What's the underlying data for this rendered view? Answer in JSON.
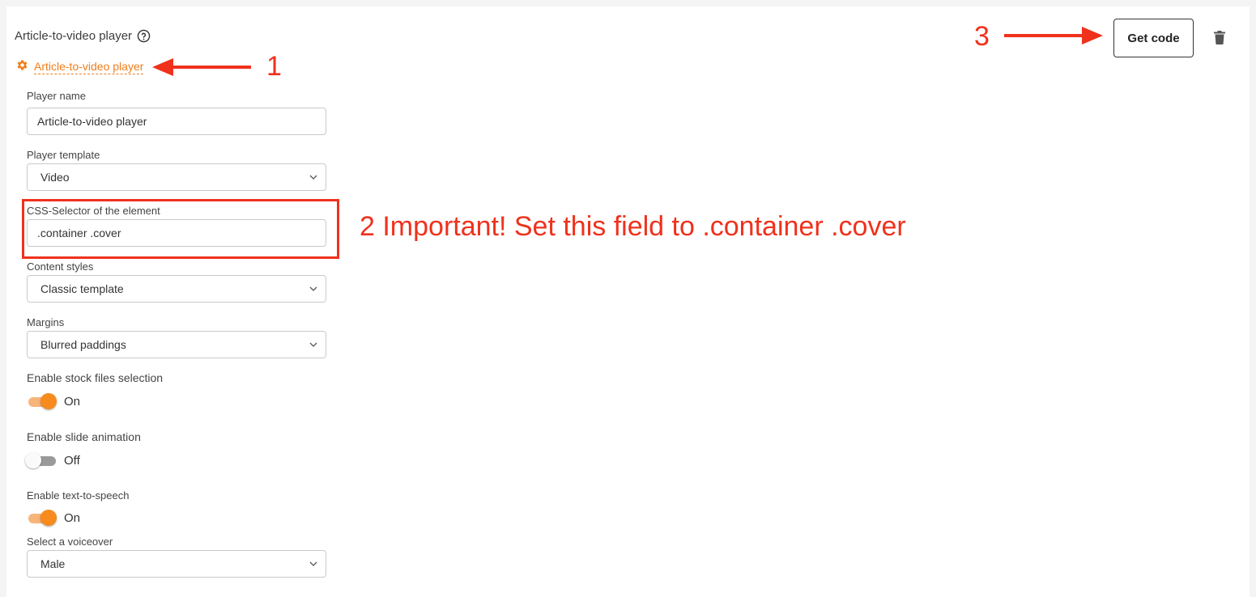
{
  "header": {
    "title": "Article-to-video player",
    "settings_link": "Article-to-video player",
    "get_code_label": "Get code"
  },
  "form": {
    "player_name": {
      "label": "Player name",
      "value": "Article-to-video player"
    },
    "player_template": {
      "label": "Player template",
      "value": "Video"
    },
    "css_selector": {
      "label": "CSS-Selector of the element",
      "value": ".container .cover"
    },
    "content_styles": {
      "label": "Content styles",
      "value": "Classic template"
    },
    "margins": {
      "label": "Margins",
      "value": "Blurred paddings"
    },
    "stock_files": {
      "label": "Enable stock files selection",
      "state": "On",
      "enabled": true
    },
    "slide_animation": {
      "label": "Enable slide animation",
      "state": "Off",
      "enabled": false
    },
    "text_to_speech": {
      "label": "Enable text-to-speech",
      "state": "On",
      "enabled": true
    },
    "voiceover": {
      "label": "Select a voiceover",
      "value": "Male"
    }
  },
  "annotations": {
    "one": "1",
    "two": "2 Important! Set this field to .container .cover",
    "three": "3"
  },
  "colors": {
    "accent": "#f07d1a",
    "annotation_red": "#f0311c",
    "toggle_on": "#f78b1e"
  },
  "icons": {
    "help": "help-circle-icon",
    "settings": "gear-icon",
    "select": "chevron-down-icon",
    "delete": "trash-icon"
  }
}
